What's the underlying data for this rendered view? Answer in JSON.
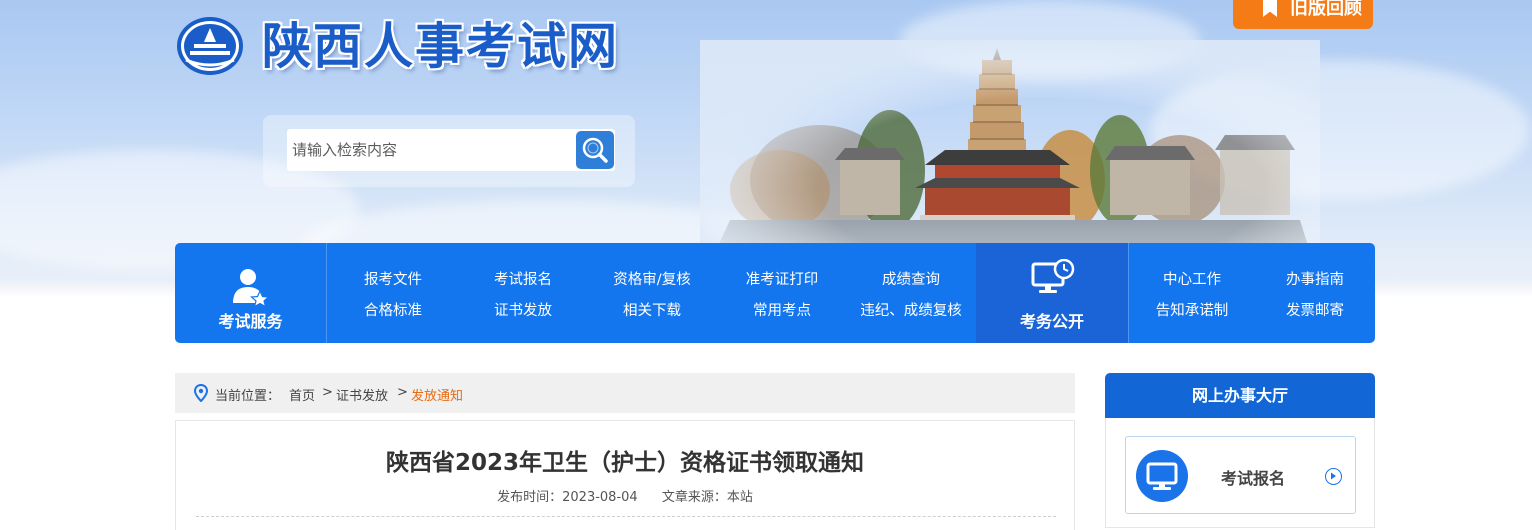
{
  "header": {
    "site_title": "陕西人事考试网",
    "old_version_label": "旧版回顾",
    "search_placeholder": "请输入检索内容"
  },
  "nav": {
    "exam_service_label": "考试服务",
    "links": [
      {
        "label": "报考文件"
      },
      {
        "label": "考试报名"
      },
      {
        "label": "资格审/复核"
      },
      {
        "label": "准考证打印"
      },
      {
        "label": "成绩查询"
      },
      {
        "label": "合格标准"
      },
      {
        "label": "证书发放"
      },
      {
        "label": "相关下载"
      },
      {
        "label": "常用考点"
      },
      {
        "label": "违纪、成绩复核"
      }
    ],
    "exam_public_label": "考务公开",
    "right_links": [
      {
        "label": "中心工作"
      },
      {
        "label": "办事指南"
      },
      {
        "label": "告知承诺制"
      },
      {
        "label": "发票邮寄"
      }
    ]
  },
  "breadcrumb": {
    "prefix": "当前位置：",
    "items": [
      "首页",
      "证书发放",
      "发放通知"
    ],
    "separator": ">"
  },
  "article": {
    "title": "陕西省2023年卫生（护士）资格证书领取通知",
    "publish_label": "发布时间：",
    "publish_date": "2023-08-04",
    "source_label": "文章来源：",
    "source": "本站"
  },
  "side": {
    "header": "网上办事大厅",
    "items": [
      {
        "label": "考试报名"
      }
    ]
  },
  "colors": {
    "primary": "#1476ee",
    "accent_orange": "#f47b16",
    "breadcrumb_current": "#e86a10"
  }
}
